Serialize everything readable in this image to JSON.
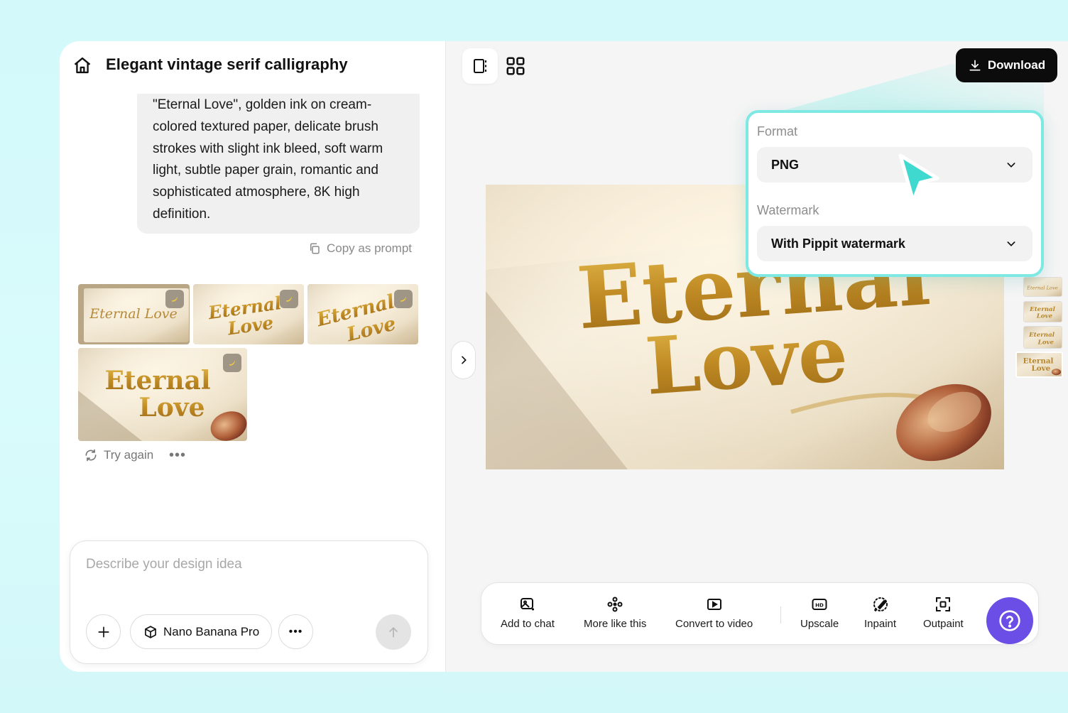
{
  "header": {
    "title": "Elegant vintage serif calligraphy"
  },
  "chat": {
    "prompt_text": "\"Eternal Love\", golden ink on cream-colored textured paper, delicate brush strokes with slight ink bleed, soft warm light, subtle paper grain, romantic and sophisticated atmosphere, 8K high definition.",
    "copy_label": "Copy as prompt",
    "thumbnails": [
      {
        "text_line1": "Eternal Love",
        "text_line2": ""
      },
      {
        "text_line1": "Eternal",
        "text_line2": "Love"
      },
      {
        "text_line1": "Eternal",
        "text_line2": "Love"
      },
      {
        "text_line1": "Eternal",
        "text_line2": "Love"
      }
    ],
    "try_again_label": "Try again",
    "more_label": "•••"
  },
  "composer": {
    "placeholder": "Describe your design idea",
    "model_label": "Nano Banana Pro",
    "more_label": "•••"
  },
  "canvas": {
    "image_line1": "Eternal",
    "image_line2": "Love"
  },
  "download": {
    "label": "Download",
    "format_label": "Format",
    "format_value": "PNG",
    "watermark_label": "Watermark",
    "watermark_value": "With Pippit watermark"
  },
  "toolbar": {
    "add_to_chat": "Add to chat",
    "more_like_this": "More like this",
    "convert_to_video": "Convert to video",
    "upscale": "Upscale",
    "inpaint": "Inpaint",
    "outpaint": "Outpaint"
  },
  "colors": {
    "accent_teal": "#7ee9e3",
    "cursor_teal": "#3fd9cf",
    "help_purple": "#6a4ee6",
    "gold": "#c99a2e",
    "paper": "#efe4cf"
  },
  "icons": [
    "home-icon",
    "copy-icon",
    "banana-icon",
    "refresh-icon",
    "plus-icon",
    "cube-icon",
    "send-arrow-icon",
    "single-view-icon",
    "grid-view-icon",
    "download-icon",
    "chevron-right-icon",
    "chevron-down-icon",
    "cursor-pointer-icon",
    "add-to-chat-icon",
    "more-like-this-icon",
    "convert-to-video-icon",
    "upscale-hd-icon",
    "inpaint-icon",
    "outpaint-icon",
    "help-icon"
  ]
}
